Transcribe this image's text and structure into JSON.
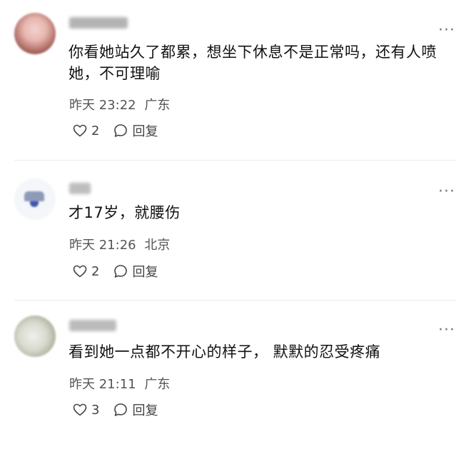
{
  "comments": [
    {
      "text": "你看她站久了都累，想坐下休息不是正常吗，还有人喷她，不可理喻",
      "date": "昨天 23:22",
      "location": "广东",
      "likes": "2",
      "reply_label": "回复",
      "more_label": "···"
    },
    {
      "text": "才17岁，就腰伤",
      "date": "昨天 21:26",
      "location": "北京",
      "likes": "2",
      "reply_label": "回复",
      "more_label": "···"
    },
    {
      "text": "看到她一点都不开心的样子， 默默的忍受疼痛",
      "date": "昨天 21:11",
      "location": "广东",
      "likes": "3",
      "reply_label": "回复",
      "more_label": "···"
    }
  ]
}
